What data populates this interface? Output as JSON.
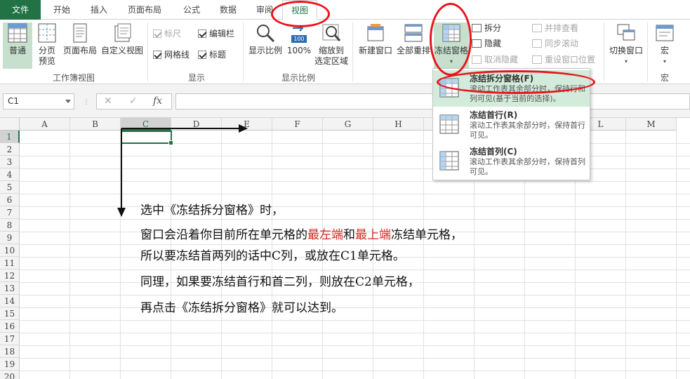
{
  "tabs": {
    "file": "文件",
    "items": [
      "开始",
      "插入",
      "页面布局",
      "公式",
      "数据",
      "审阅",
      "视图"
    ],
    "active": "视图"
  },
  "ribbon": {
    "workbook_views": {
      "label": "工作簿视图",
      "normal": "普通",
      "page_break_line1": "分页",
      "page_break_line2": "预览",
      "page_layout": "页面布局",
      "custom_views": "自定义视图"
    },
    "show": {
      "label": "显示",
      "ruler": "标尺",
      "formula_bar": "编辑栏",
      "gridlines": "网格线",
      "headings": "标题"
    },
    "zoom": {
      "label": "显示比例",
      "zoom": "显示比例",
      "zoom_100": "100%",
      "zoom_badge": "100",
      "zoom_selection_line1": "缩放到",
      "zoom_selection_line2": "选定区域"
    },
    "window": {
      "new_window": "新建窗口",
      "arrange_all": "全部重排",
      "freeze_panes": "冻结窗格",
      "split": "拆分",
      "hide": "隐藏",
      "unhide": "取消隐藏",
      "side_by_side": "并排查看",
      "sync_scroll": "同步滚动",
      "reset_position": "重设窗口位置",
      "switch_windows": "切换窗口"
    },
    "macros": {
      "label": "宏",
      "macros": "宏"
    }
  },
  "formula_bar": {
    "name_box": "C1",
    "cancel": "✕",
    "enter": "✓",
    "fx": "fx",
    "value": ""
  },
  "grid": {
    "columns": [
      "A",
      "B",
      "C",
      "D",
      "E",
      "F",
      "G",
      "H",
      "I",
      "J",
      "K",
      "L",
      "M"
    ],
    "rows": [
      "1",
      "2",
      "3",
      "4",
      "5",
      "6",
      "7",
      "8",
      "9",
      "10",
      "11",
      "12",
      "13",
      "14",
      "15",
      "16",
      "17",
      "18",
      "19",
      "20"
    ],
    "selected_column": "C",
    "selected_row": "1"
  },
  "freeze_menu": {
    "items": [
      {
        "title": "冻结拆分窗格(F)",
        "desc": "滚动工作表其余部分时，保持行和列可见(基于当前的选择)。"
      },
      {
        "title": "冻结首行(R)",
        "desc": "滚动工作表其余部分时，保持首行可见。"
      },
      {
        "title": "冻结首列(C)",
        "desc": "滚动工作表其余部分时，保持首列可见。"
      }
    ]
  },
  "annotation": {
    "line1": "选中《冻结拆分窗格》时，",
    "line2_a": "窗口会沿着你目前所在单元格的",
    "line2_red1": "最左端",
    "line2_b": "和",
    "line2_red2": "最上端",
    "line2_c": "冻结单元格，",
    "line3": "所以要冻结首两列的话中C列，或放在C1单元格。",
    "line4": "同理，如果要冻结首行和首二列，则放在C2单元格，",
    "line5": "再点击《冻结拆分窗格》就可以达到。"
  },
  "colors": {
    "excel_green": "#217346",
    "highlight_red": "#e8141b",
    "text_red": "#d4271f",
    "menu_hover": "#d3ebda"
  }
}
